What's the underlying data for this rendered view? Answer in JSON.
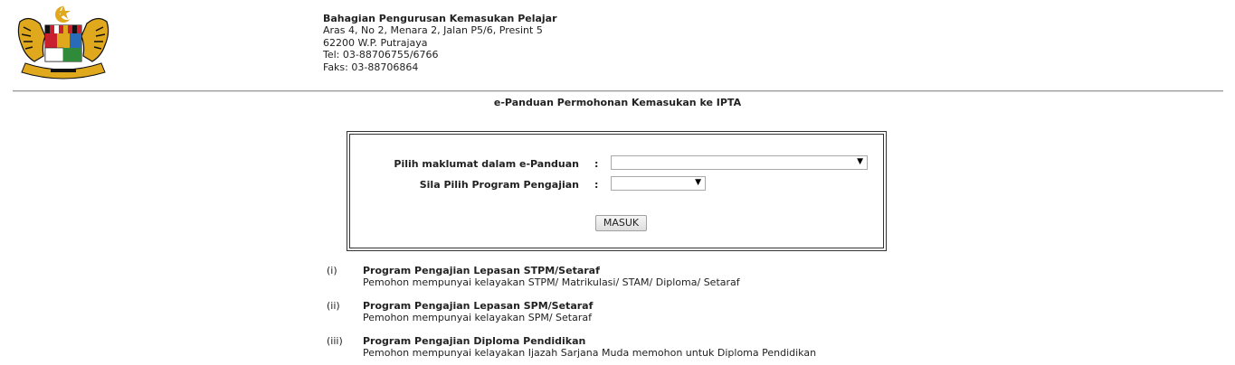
{
  "header": {
    "org_name": "Bahagian Pengurusan Kemasukan Pelajar",
    "address_line1": "Aras 4, No 2, Menara 2, Jalan P5/6, Presint 5",
    "address_line2": "62200 W.P. Putrajaya",
    "tel": "Tel: 03-88706755/6766",
    "fax": "Faks: 03-88706864",
    "logo_icon": "malaysia-coat-of-arms-icon"
  },
  "page_title": "e-Panduan Permohonan Kemasukan ke IPTA",
  "form": {
    "field1_label": "Pilih maklumat dalam e-Panduan",
    "field1_value": "",
    "field2_label": "Sila Pilih Program Pengajian",
    "field2_value": "",
    "colon": ":",
    "submit_label": "MASUK"
  },
  "programs": [
    {
      "num": "(i)",
      "title": "Program Pengajian Lepasan STPM/Setaraf",
      "desc": "Pemohon mempunyai kelayakan STPM/ Matrikulasi/ STAM/ Diploma/ Setaraf"
    },
    {
      "num": "(ii)",
      "title": "Program Pengajian Lepasan SPM/Setaraf",
      "desc": "Pemohon mempunyai kelayakan SPM/ Setaraf"
    },
    {
      "num": "(iii)",
      "title": "Program Pengajian Diploma Pendidikan",
      "desc": "Pemohon mempunyai kelayakan Ijazah Sarjana Muda memohon untuk Diploma Pendidikan"
    }
  ],
  "colors": {
    "text": "#222222",
    "rule": "#999999",
    "border": "#333333",
    "logo_gold": "#e0a81c",
    "logo_red": "#c8202f",
    "logo_black": "#111111"
  }
}
